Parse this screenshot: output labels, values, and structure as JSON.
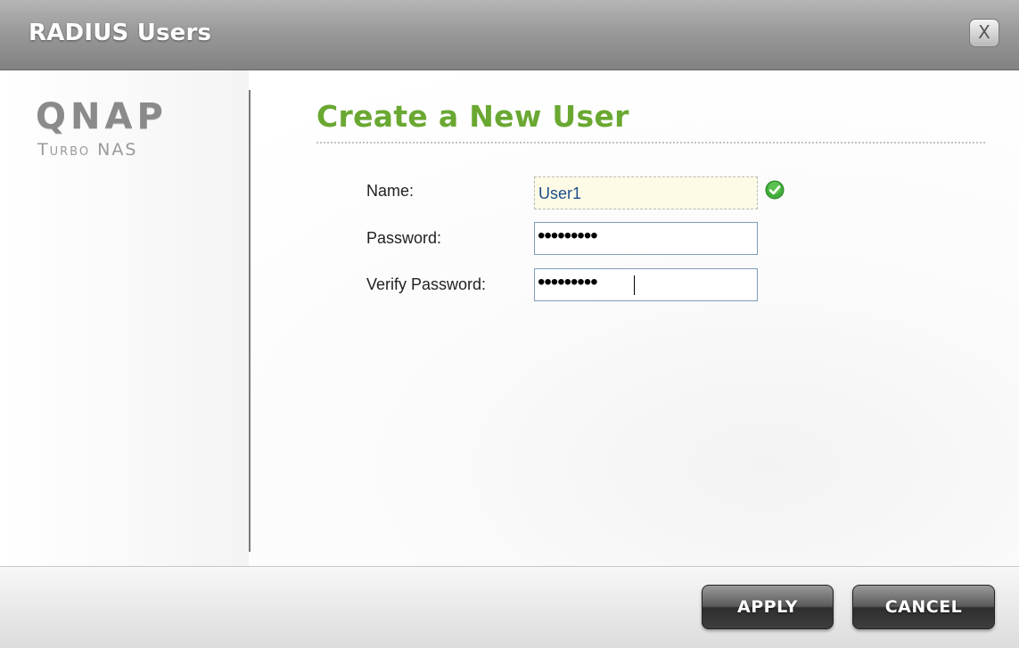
{
  "dialog": {
    "title": "RADIUS Users",
    "close_label": "X"
  },
  "logo": {
    "main": "QNAP",
    "sub": "Turbo NAS"
  },
  "form": {
    "heading": "Create a New User",
    "name": {
      "label": "Name:",
      "value": "User1",
      "valid_icon": "check-icon"
    },
    "password": {
      "label": "Password:",
      "value": "•••••••••"
    },
    "verify_password": {
      "label": "Verify Password:",
      "value": "•••••••••"
    }
  },
  "buttons": {
    "apply": "APPLY",
    "cancel": "CANCEL"
  },
  "colors": {
    "heading": "#6aa832",
    "valid_check": "#3fae3a",
    "input_border": "#7f9db9",
    "name_field_bg": "#fdfbe6",
    "name_value": "#1e4d8c"
  }
}
